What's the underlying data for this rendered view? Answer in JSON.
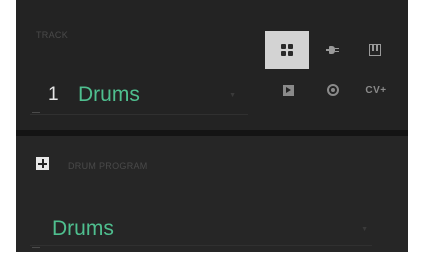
{
  "track": {
    "label": "TRACK",
    "number": "1",
    "name": "Drums",
    "type_buttons": [
      {
        "name": "drum-grid",
        "icon": "grid-icon",
        "active": true
      },
      {
        "name": "plugin",
        "icon": "plug-icon",
        "active": false
      },
      {
        "name": "keygroup",
        "icon": "keys-icon",
        "active": false
      },
      {
        "name": "clip",
        "icon": "clip-icon",
        "active": false
      },
      {
        "name": "audio",
        "icon": "audio-icon",
        "active": false
      },
      {
        "name": "cv",
        "label": "CV+",
        "active": false
      }
    ]
  },
  "program": {
    "label": "DRUM PROGRAM",
    "name": "Drums"
  },
  "colors": {
    "accent": "#4fbf8f",
    "panel": "#232323",
    "active_button": "#d3d3d3"
  }
}
